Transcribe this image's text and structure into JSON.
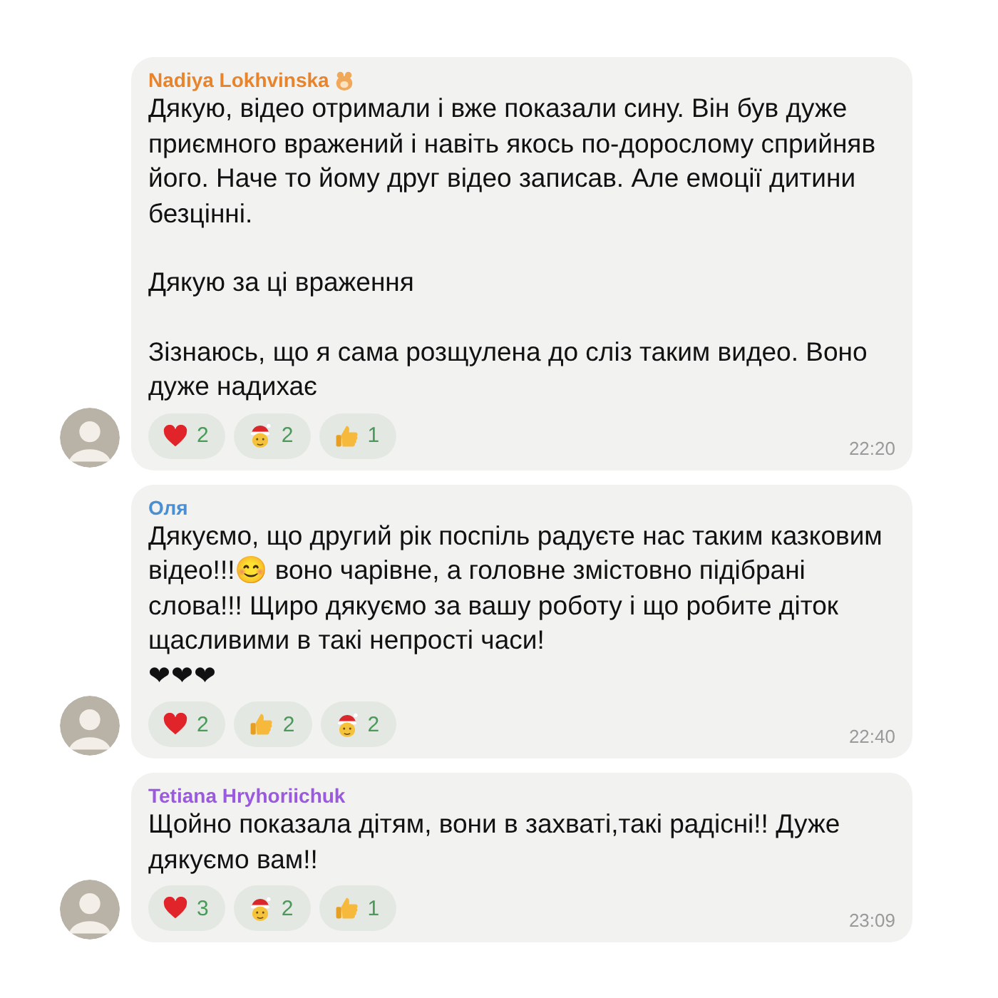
{
  "messages": [
    {
      "author": "Nadiya Lokhvinska",
      "color": "#e8852c",
      "status_badge": true,
      "paragraphs": [
        "Дякую, відео отримали і вже показали сину. Він був дуже приємного вражений і навіть якось по-дорослому сприйняв його. Наче то йому друг відео записав. Але емоції дитини безцінні.",
        "Дякую за ці враження",
        "Зізнаюсь, що я сама розщулена до сліз таким видео. Воно дуже надихає"
      ],
      "reactions": [
        {
          "kind": "heart",
          "count": "2"
        },
        {
          "kind": "santa",
          "count": "2"
        },
        {
          "kind": "thumbs",
          "count": "1"
        }
      ],
      "time": "22:20"
    },
    {
      "author": "Оля",
      "color": "#4a8fd1",
      "status_badge": false,
      "paragraphs": [
        "Дякуємо, що другий рік поспіль радуєте нас таким казковим відео!!!😊 воно чарівне, а головне змістовно підібрані слова!!! Щиро дякуємо за вашу роботу і що робите діток щасливими в такі непрості часи!\n❤❤❤"
      ],
      "reactions": [
        {
          "kind": "heart",
          "count": "2"
        },
        {
          "kind": "thumbs",
          "count": "2"
        },
        {
          "kind": "santa",
          "count": "2"
        }
      ],
      "time": "22:40"
    },
    {
      "author": "Tetiana Hryhoriichuk",
      "color": "#9b59e0",
      "status_badge": false,
      "paragraphs": [
        "Щойно показала дітям, вони в захваті,такі радісні!! Дуже дякуємо вам!!"
      ],
      "reactions": [
        {
          "kind": "heart",
          "count": "3"
        },
        {
          "kind": "santa",
          "count": "2"
        },
        {
          "kind": "thumbs",
          "count": "1"
        }
      ],
      "time": "23:09"
    }
  ]
}
